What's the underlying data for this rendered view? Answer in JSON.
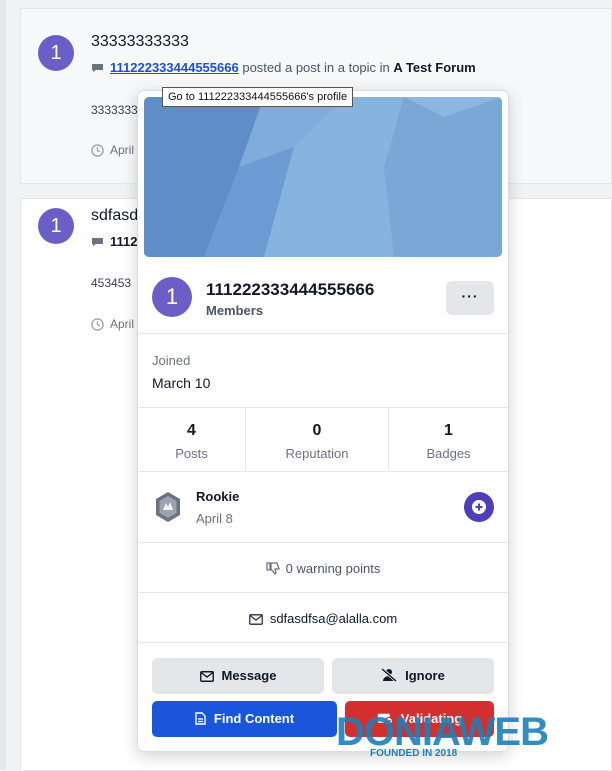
{
  "posts": [
    {
      "avatar_letter": "1",
      "title": "33333333333",
      "author": "111222333444555666",
      "meta_mid": "posted a post in a topic in",
      "forum": "A Test Forum",
      "excerpt": "3333333",
      "date": "April"
    },
    {
      "avatar_letter": "1",
      "title": "sdfasd",
      "author": "1112",
      "excerpt": "453453",
      "date": "April"
    }
  ],
  "tooltip": "Go to 111222333444555666's profile",
  "hovercard": {
    "avatar_letter": "1",
    "username": "111222333444555666",
    "group": "Members",
    "more_label": "···",
    "joined_label": "Joined",
    "joined_value": "March 10",
    "stats": [
      {
        "value": "4",
        "label": "Posts"
      },
      {
        "value": "0",
        "label": "Reputation"
      },
      {
        "value": "1",
        "label": "Badges"
      }
    ],
    "rank": {
      "name": "Rookie",
      "date": "April 8"
    },
    "warning": "0 warning points",
    "email": "sdfasdfsa@alalla.com",
    "buttons": {
      "message": "Message",
      "ignore": "Ignore",
      "find_content": "Find Content",
      "validating": "Validating"
    }
  },
  "watermark": {
    "brand": "DONIAWEB",
    "tagline": "FOUNDED IN 2018"
  },
  "colors": {
    "accent": "#1a56db",
    "danger": "#d32f2f",
    "avatar": "#6b5fc7",
    "link": "#1d4ed8"
  }
}
